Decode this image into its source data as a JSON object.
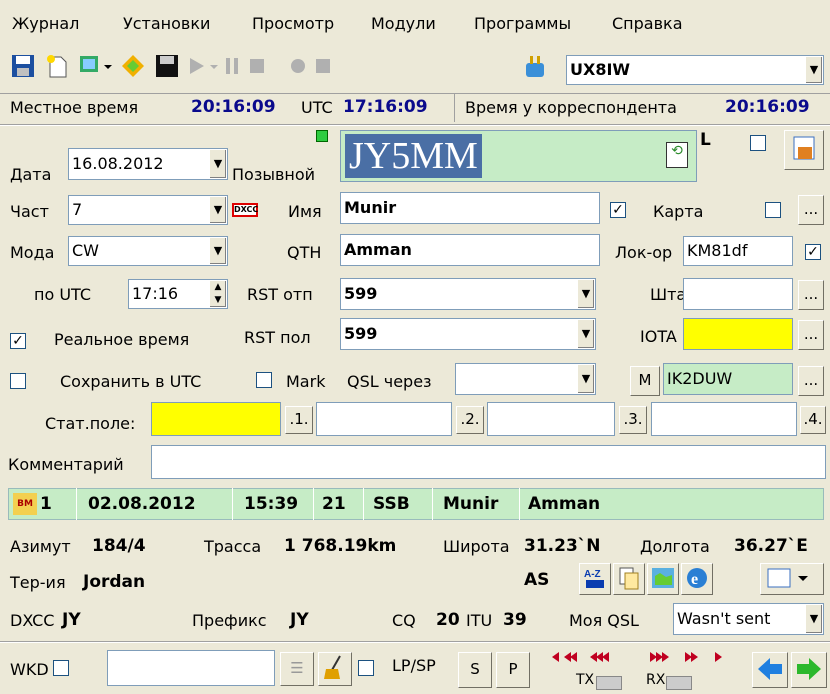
{
  "menu": [
    "Журнал",
    "Установки",
    "Просмотр",
    "Модули",
    "Программы",
    "Справка"
  ],
  "toolbar": {
    "callsign_select": "UX8IW"
  },
  "timebar": {
    "local_label": "Местное время",
    "local_time": "20:16:09",
    "utc_label": "UTC",
    "utc_time": "17:16:09",
    "corr_label": "Время у корреспондента",
    "corr_time": "20:16:09"
  },
  "form": {
    "date_label": "Дата",
    "date": "16.08.2012",
    "call_label": "Позывной",
    "call": "JY5MM",
    "l_label": "L",
    "freq_label": "Част",
    "freq": "7",
    "name_label": "Имя",
    "name": "Munir",
    "card_label": "Карта",
    "card_checked": true,
    "mode_label": "Мода",
    "mode": "CW",
    "qth_label": "QTH",
    "qth": "Amman",
    "loc_label": "Лок-ор",
    "loc": "KM81df",
    "loc_checked": true,
    "utc_label": "по UTC",
    "utc": "17:16",
    "rst_sent_label": "RST отп",
    "rst_sent": "599",
    "state_label": "Штат",
    "state": "",
    "realtime_label": "Реальное время",
    "realtime_checked": true,
    "rst_rcvd_label": "RST пол",
    "rst_rcvd": "599",
    "iota_label": "IOTA",
    "iota": "",
    "save_utc_label": "Сохранить в UTC",
    "mark_label": "Mark",
    "qsl_via_label": "QSL через",
    "qsl_via": "",
    "m_button": "M",
    "manager": "IK2DUW",
    "stat_label": "Стат.поле:",
    "stat1": ".1.",
    "stat2": ".2.",
    "stat3": ".3.",
    "stat4": ".4.",
    "comment_label": "Комментарий",
    "comment": "",
    "dots": "..."
  },
  "prev_qso": {
    "num": "1",
    "date": "02.08.2012",
    "time": "15:39",
    "band": "21",
    "mode": "SSB",
    "name": "Munir",
    "qth": "Amman"
  },
  "info": {
    "az_label": "Азимут",
    "az": "184/4",
    "path_label": "Трасса",
    "path": "1 768.19km",
    "lat_label": "Широта",
    "lat": "31.23`N",
    "lon_label": "Долгота",
    "lon": "36.27`E",
    "terr_label": "Тер-ия",
    "terr": "Jordan",
    "cont": "AS",
    "dxcc_label": "DXCC",
    "dxcc": "JY",
    "prefix_label": "Префикс",
    "prefix": "JY",
    "cq_label": "CQ",
    "cq": "20",
    "itu_label": "ITU",
    "itu": "39",
    "myqsl_label": "Моя QSL",
    "myqsl": "Wasn't sent"
  },
  "bottom": {
    "wkd_label": "WKD",
    "lpsp_label": "LP/SP",
    "s_btn": "S",
    "p_btn": "P",
    "tx_label": "TX",
    "rx_label": "RX"
  },
  "colors": {
    "time_blue": "#0a0a8c",
    "call_bg": "#c6ecc6",
    "yellow": "#ffff00"
  }
}
